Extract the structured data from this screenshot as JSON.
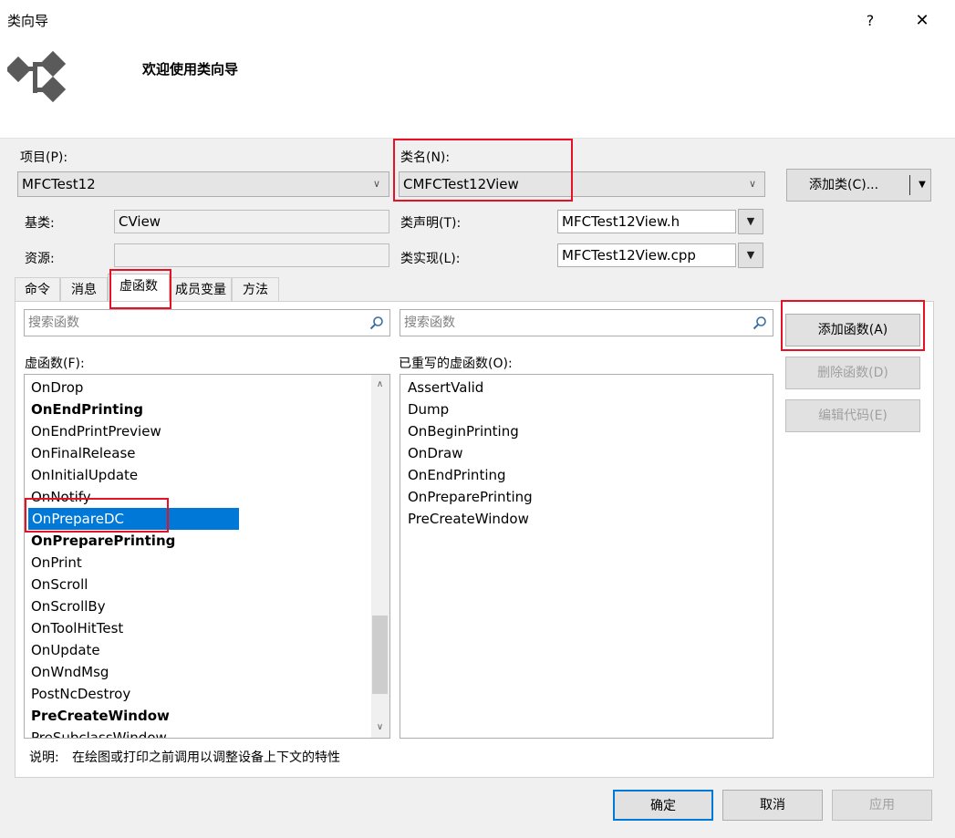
{
  "window": {
    "title": "类向导",
    "help": "?",
    "close": "✕",
    "welcome": "欢迎使用类向导",
    "logo_icon": "class-wizard-logo-icon"
  },
  "fields": {
    "project_label": "项目(P):",
    "project_value": "MFCTest12",
    "classname_label": "类名(N):",
    "classname_value": "CMFCTest12View",
    "add_class_button": "添加类(C)...",
    "baseclass_label": "基类:",
    "baseclass_value": "CView",
    "resource_label": "资源:",
    "resource_value": "",
    "declaration_label": "类声明(T):",
    "declaration_value": "MFCTest12View.h",
    "implementation_label": "类实现(L):",
    "implementation_value": "MFCTest12View.cpp"
  },
  "tabs": [
    "命令",
    "消息",
    "虚函数",
    "成员变量",
    "方法"
  ],
  "active_tab": "虚函数",
  "panel": {
    "search_placeholder_left": "搜索函数",
    "search_placeholder_right": "搜索函数",
    "virtual_label": "虚函数(F):",
    "overridden_label": "已重写的虚函数(O):",
    "virtual_functions": [
      {
        "name": "OnDrop",
        "bold": false,
        "selected": false
      },
      {
        "name": "OnEndPrinting",
        "bold": true,
        "selected": false
      },
      {
        "name": "OnEndPrintPreview",
        "bold": false,
        "selected": false
      },
      {
        "name": "OnFinalRelease",
        "bold": false,
        "selected": false
      },
      {
        "name": "OnInitialUpdate",
        "bold": false,
        "selected": false
      },
      {
        "name": "OnNotify",
        "bold": false,
        "selected": false
      },
      {
        "name": "OnPrepareDC",
        "bold": false,
        "selected": true
      },
      {
        "name": "OnPreparePrinting",
        "bold": true,
        "selected": false
      },
      {
        "name": "OnPrint",
        "bold": false,
        "selected": false
      },
      {
        "name": "OnScroll",
        "bold": false,
        "selected": false
      },
      {
        "name": "OnScrollBy",
        "bold": false,
        "selected": false
      },
      {
        "name": "OnToolHitTest",
        "bold": false,
        "selected": false
      },
      {
        "name": "OnUpdate",
        "bold": false,
        "selected": false
      },
      {
        "name": "OnWndMsg",
        "bold": false,
        "selected": false
      },
      {
        "name": "PostNcDestroy",
        "bold": false,
        "selected": false
      },
      {
        "name": "PreCreateWindow",
        "bold": true,
        "selected": false
      },
      {
        "name": "PreSubclassWindow",
        "bold": false,
        "selected": false
      }
    ],
    "overridden_functions": [
      "AssertValid",
      "Dump",
      "OnBeginPrinting",
      "OnDraw",
      "OnEndPrinting",
      "OnPreparePrinting",
      "PreCreateWindow"
    ],
    "add_function_button": "添加函数(A)",
    "delete_function_button": "删除函数(D)",
    "edit_code_button": "编辑代码(E)",
    "description_label": "说明:",
    "description_text": "在绘图或打印之前调用以调整设备上下文的特性"
  },
  "footer": {
    "ok": "确定",
    "cancel": "取消",
    "apply": "应用"
  },
  "colors": {
    "selection": "#0078d7",
    "highlight_box": "#e81123",
    "disabled_text": "#a0a0a0"
  }
}
